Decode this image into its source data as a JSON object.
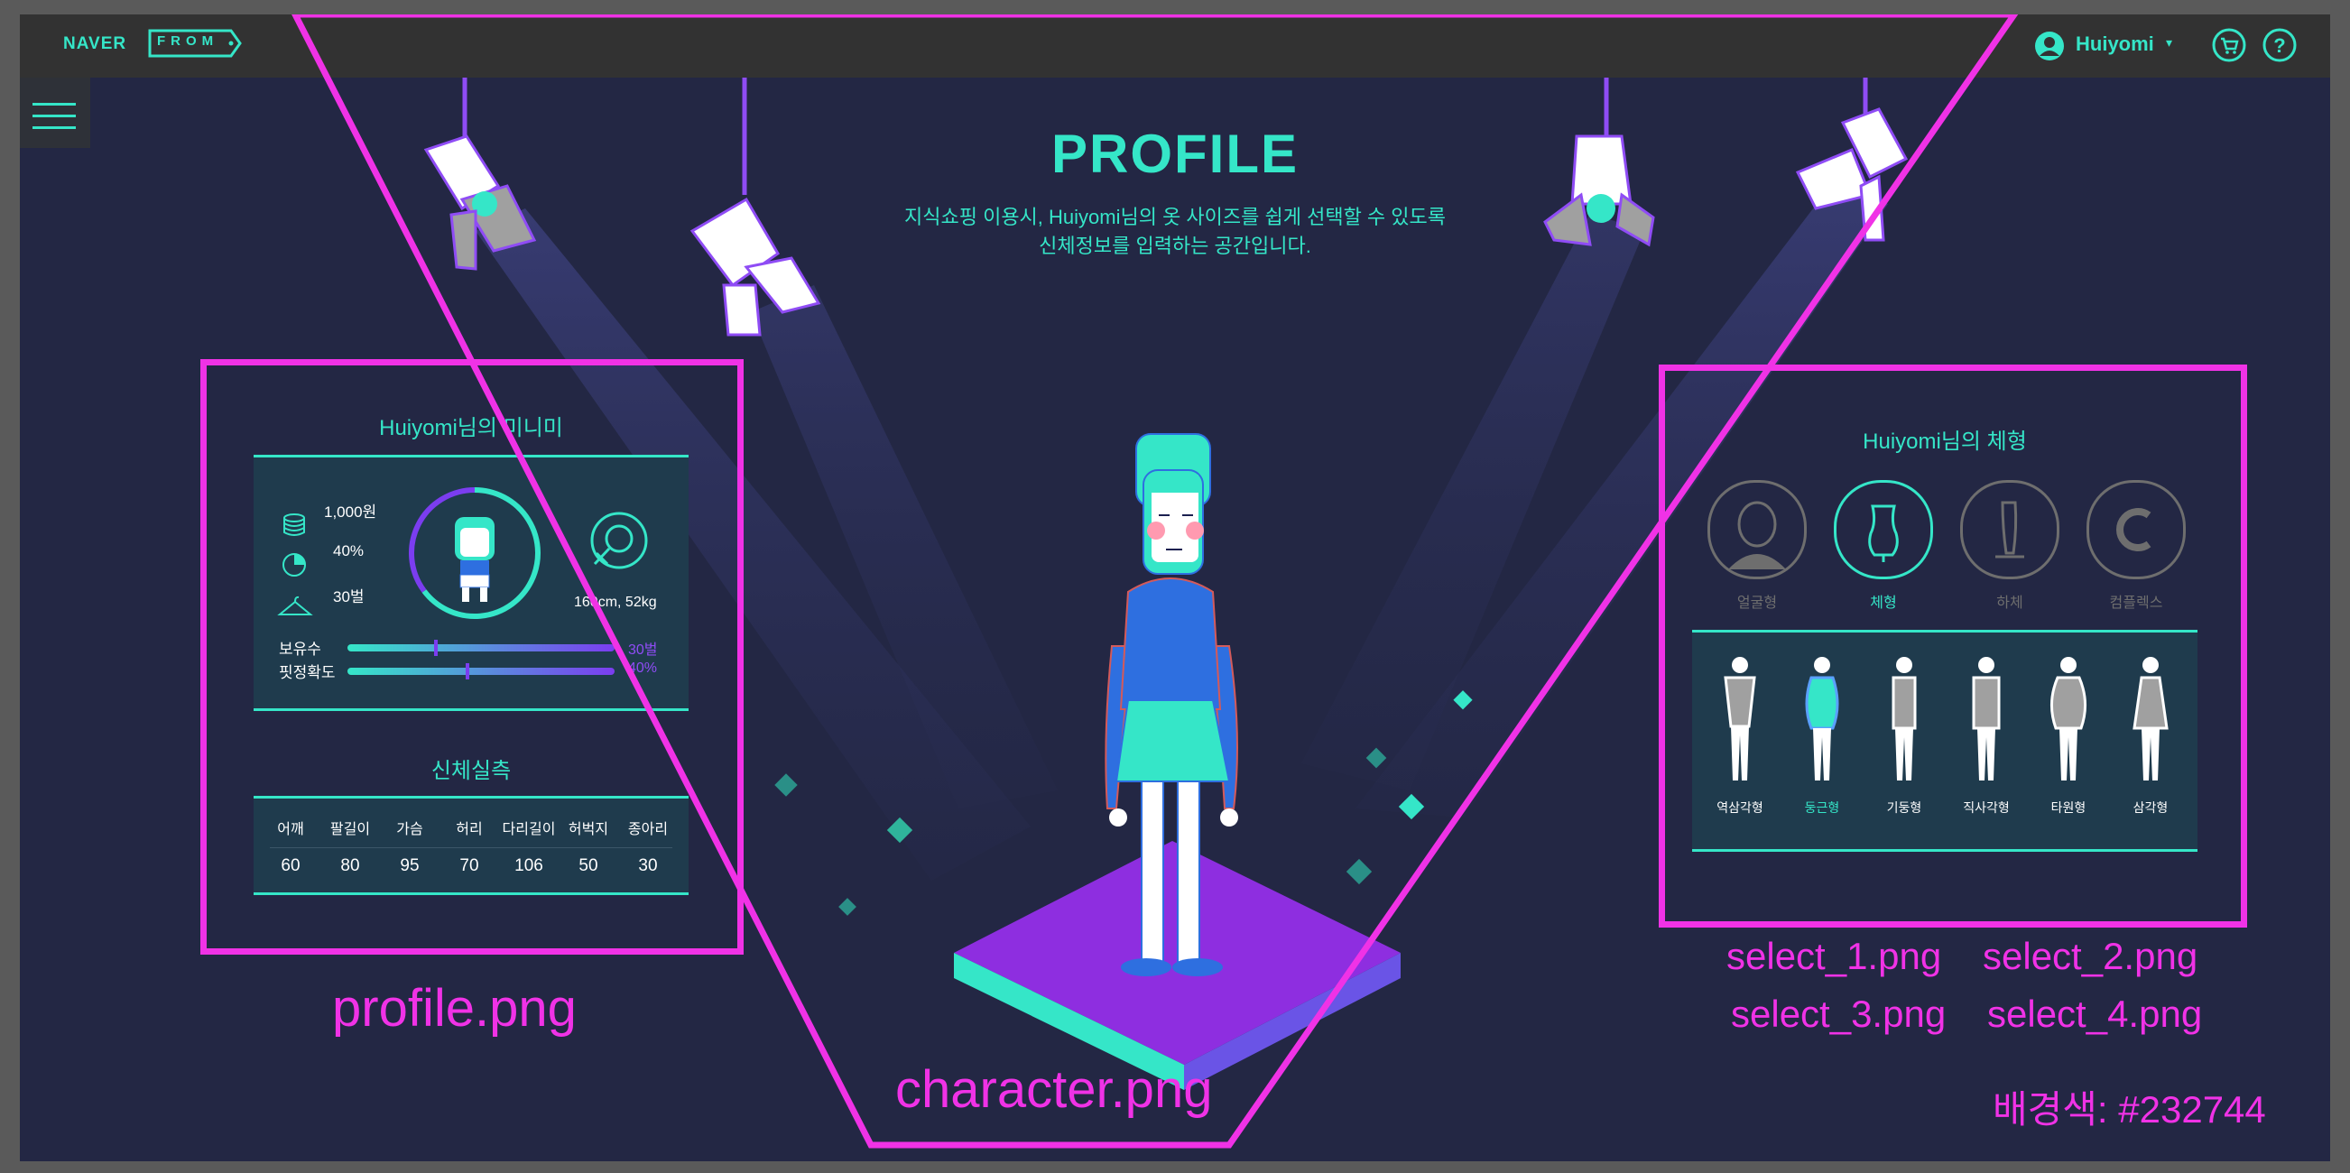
{
  "header": {
    "brand": "NAVER",
    "logo_text": "FROM",
    "user_name": "Huiyomi",
    "caret": "▾"
  },
  "hero": {
    "title": "PROFILE",
    "subtitle_line1": "지식쇼핑 이용시, Huiyomi님의 옷 사이즈를 쉽게 선택할 수 있도록",
    "subtitle_line2": "신체정보를 입력하는 공간입니다."
  },
  "profile_panel": {
    "mini_title": "Huiyomi님의 미니미",
    "stats": [
      "1,000원",
      "40%",
      "30벌"
    ],
    "size_weight": "160cm, 52kg",
    "sliders": [
      {
        "label": "보유수",
        "value_text": "30벌",
        "fraction": 0.33
      },
      {
        "label": "핏정확도",
        "value_text": "40%",
        "fraction": 0.45
      }
    ],
    "measure_title": "신체실측",
    "measure_headers": [
      "어깨",
      "팔길이",
      "가슴",
      "허리",
      "다리길이",
      "허벅지",
      "종아리"
    ],
    "measure_values": [
      "60",
      "80",
      "95",
      "70",
      "106",
      "50",
      "30"
    ]
  },
  "shape_panel": {
    "title": "Huiyomi님의 체형",
    "categories": [
      {
        "label": "얼굴형",
        "active": false
      },
      {
        "label": "체형",
        "active": true
      },
      {
        "label": "하체",
        "active": false
      },
      {
        "label": "컴플렉스",
        "active": false
      }
    ],
    "shapes": [
      {
        "label": "역삼각형",
        "active": false
      },
      {
        "label": "둥근형",
        "active": true
      },
      {
        "label": "기둥형",
        "active": false
      },
      {
        "label": "직사각형",
        "active": false
      },
      {
        "label": "타원형",
        "active": false
      },
      {
        "label": "삼각형",
        "active": false
      }
    ]
  },
  "annotations": {
    "profile_label": "profile.png",
    "character_label": "character.png",
    "select_1": "select_1.png",
    "select_2": "select_2.png",
    "select_3": "select_3.png",
    "select_4": "select_4.png",
    "bg_label": "배경색: #232744"
  },
  "colors": {
    "background": "#232744",
    "accent": "#35e6c8",
    "annotation": "#f032e6",
    "purple": "#7b3df0"
  }
}
